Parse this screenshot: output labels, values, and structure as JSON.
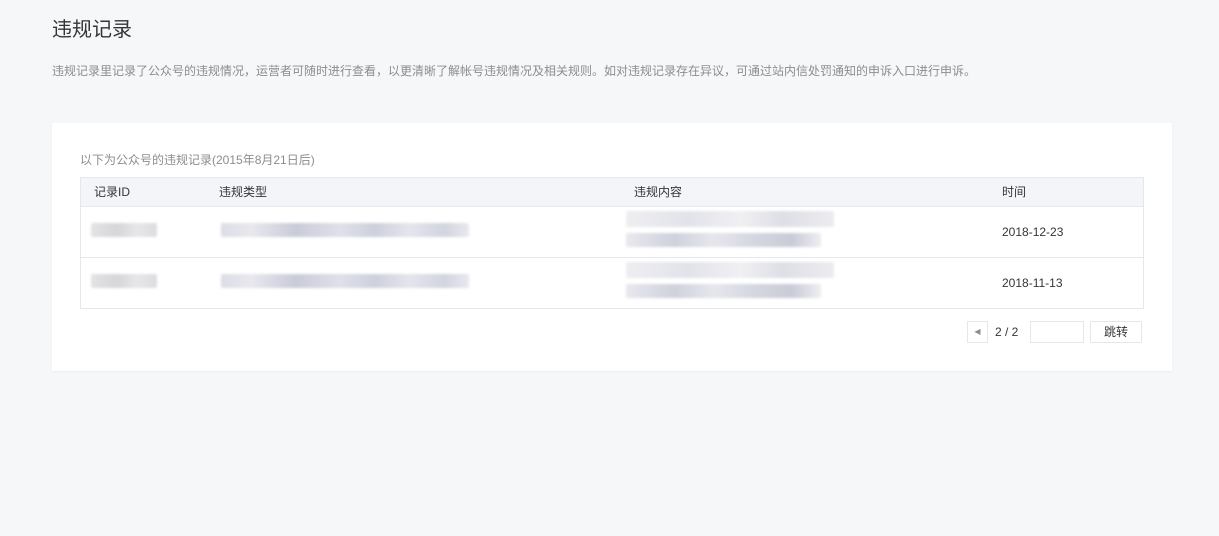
{
  "page": {
    "title": "违规记录",
    "description": "违规记录里记录了公众号的违规情况，运营者可随时进行查看，以更清晰了解帐号违规情况及相关规则。如对违规记录存在异议，可通过站内信处罚通知的申诉入口进行申诉。"
  },
  "records": {
    "caption": "以下为公众号的违规记录(2015年8月21日后)",
    "columns": {
      "id": "记录ID",
      "type": "违规类型",
      "content": "违规内容",
      "time": "时间"
    },
    "rows": [
      {
        "time": "2018-12-23"
      },
      {
        "time": "2018-11-13"
      }
    ]
  },
  "pagination": {
    "prev_icon": "triangle-left-icon",
    "info": "2 / 2",
    "input_value": "",
    "go_label": "跳转"
  }
}
